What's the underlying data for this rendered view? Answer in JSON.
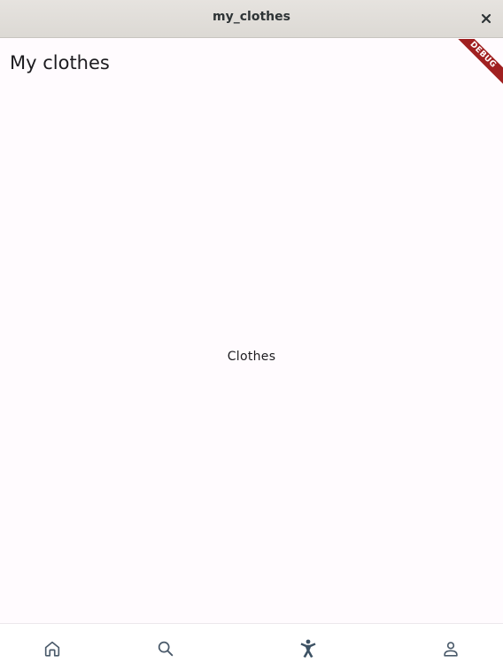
{
  "window": {
    "title": "my_clothes",
    "close_icon": "close-icon"
  },
  "appbar": {
    "title": "My clothes"
  },
  "debug_banner": {
    "label": "DEBUG",
    "color": "#a02020"
  },
  "main": {
    "text": "Clothes"
  },
  "navbar": {
    "items": [
      {
        "icon": "home-icon"
      },
      {
        "icon": "search-icon"
      },
      {
        "icon": "accessibility-icon",
        "selected": true
      },
      {
        "icon": "person-icon"
      }
    ]
  },
  "colors": {
    "background": "#fffbfe",
    "nav_icon": "#4a5a6a",
    "nav_icon_selected": "#3d5264"
  }
}
